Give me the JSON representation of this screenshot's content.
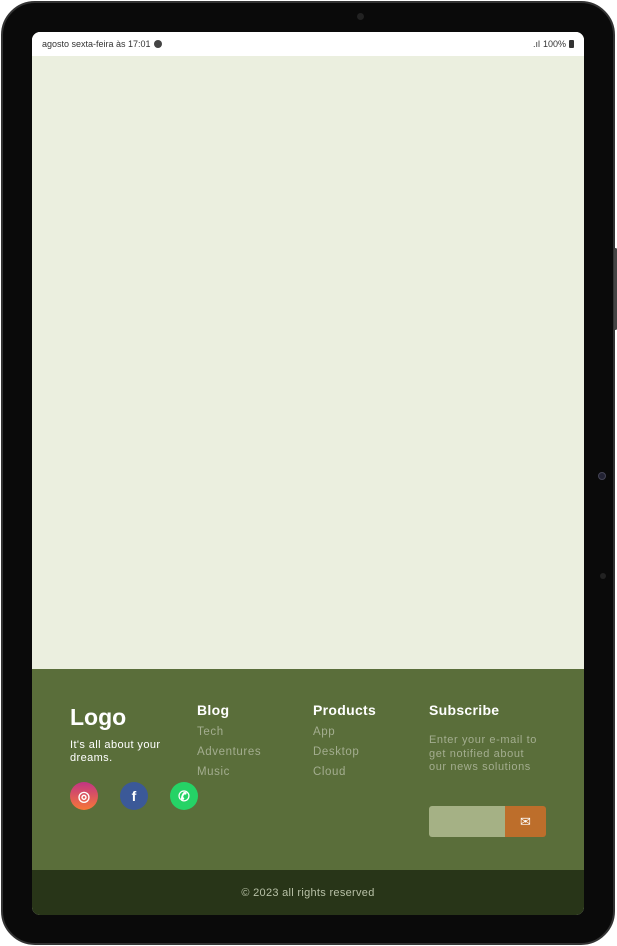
{
  "status_bar": {
    "left": "agosto sexta-feira às 17:01",
    "right": "100%",
    "icons": [
      "spotify-icon",
      "signal-icon",
      "battery-icon"
    ]
  },
  "footer": {
    "logo": "Logo",
    "tagline": "It's all about your dreams.",
    "social": [
      {
        "name": "instagram",
        "color": "#d62976"
      },
      {
        "name": "facebook",
        "color": "#3b5998"
      },
      {
        "name": "whatsapp",
        "color": "#25d366"
      }
    ],
    "blog": {
      "title": "Blog",
      "items": [
        "Tech",
        "Adventures",
        "Music"
      ]
    },
    "products": {
      "title": "Products",
      "items": [
        "App",
        "Desktop",
        "Cloud"
      ]
    },
    "subscribe": {
      "title": "Subscribe",
      "text": "Enter your e-mail to get notified about our news solutions",
      "email_value": "",
      "button_icon": "envelope-icon"
    },
    "copyright": "© 2023 all rights reserved"
  },
  "colors": {
    "page_bg": "#ebefdf",
    "footer": "#5a6e3a",
    "bottom_bar": "#283518",
    "accent": "#bd6e2b"
  }
}
